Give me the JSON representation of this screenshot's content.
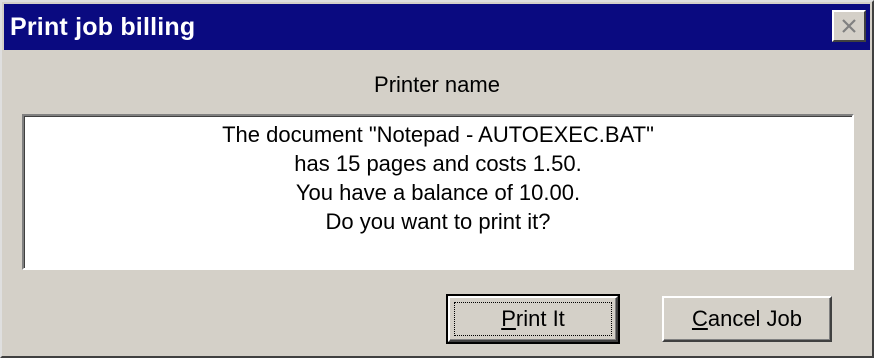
{
  "window": {
    "title": "Print job billing",
    "close_icon": "close-icon"
  },
  "printer": {
    "label": "Printer name"
  },
  "message": {
    "lines": [
      "The document \"Notepad - AUTOEXEC.BAT\"",
      "has 15 pages and costs 1.50.",
      "You have a balance of 10.00.",
      "Do you want to print it?"
    ]
  },
  "buttons": {
    "print": {
      "mnemonic": "P",
      "rest": "rint It"
    },
    "cancel": {
      "mnemonic": "C",
      "rest": "ancel Job"
    }
  },
  "colors": {
    "titlebar": "#0a0a80",
    "face": "#d4d0c8"
  }
}
